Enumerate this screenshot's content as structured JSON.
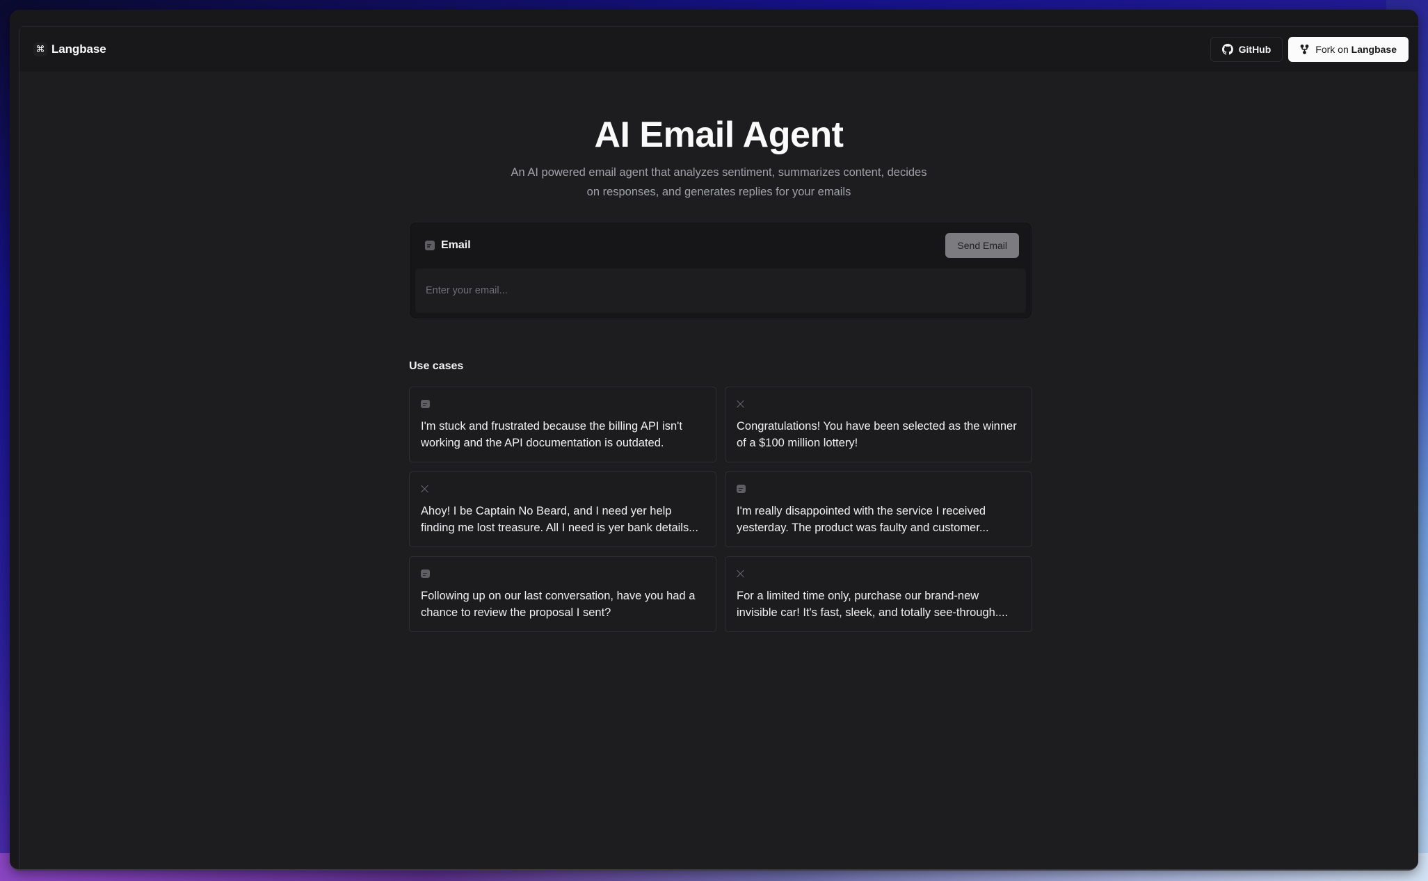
{
  "header": {
    "logo_glyph": "⌘",
    "brand": "Langbase",
    "github_label": "GitHub",
    "fork_prefix": "Fork on",
    "fork_brand": "Langbase"
  },
  "hero": {
    "title": "AI Email Agent",
    "subtitle": "An AI powered email agent that analyzes sentiment, summarizes content, decides on responses, and generates replies for your emails"
  },
  "email_form": {
    "label": "Email",
    "label_icon": "message-square-icon",
    "send_label": "Send Email",
    "input_value": "",
    "input_placeholder": "Enter your email..."
  },
  "use_cases": {
    "title": "Use cases",
    "items": [
      {
        "icon": "message-square-icon",
        "text": "I'm stuck and frustrated because the billing API isn't working and the API documentation is outdated."
      },
      {
        "icon": "x-icon",
        "text": "Congratulations! You have been selected as the winner of a $100 million lottery!"
      },
      {
        "icon": "x-icon",
        "text": "Ahoy! I be Captain No Beard, and I need yer help finding me lost treasure. All I need is yer bank details..."
      },
      {
        "icon": "message-square-icon",
        "text": "I'm really disappointed with the service I received yesterday. The product was faulty and customer..."
      },
      {
        "icon": "message-square-icon",
        "text": "Following up on our last conversation, have you had a chance to review the proposal I sent?"
      },
      {
        "icon": "x-icon",
        "text": "For a limited time only, purchase our brand-new invisible car! It's fast, sleek, and totally see-through...."
      }
    ]
  }
}
